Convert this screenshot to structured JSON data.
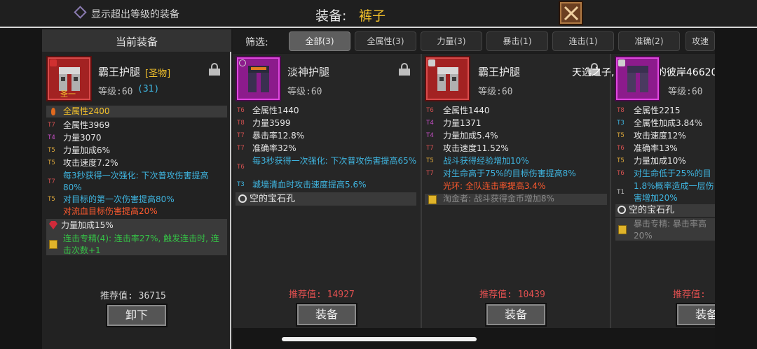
{
  "top": {
    "toggle_label": "显示超出等级的装备",
    "title_prefix": "装备:",
    "title_item": "裤子"
  },
  "left": {
    "header": "当前装备",
    "item_name": "霸王护腿",
    "item_tag": "[圣物]",
    "holy_mark": "圣一",
    "level_label": "等级:60",
    "level_bonus": "(31)",
    "stats": [
      {
        "tier": "",
        "text": "全属性2400"
      },
      {
        "tier": "T7",
        "text": "全属性3969"
      },
      {
        "tier": "T4",
        "text": "力量3070"
      },
      {
        "tier": "T5",
        "text": "力量加成6%"
      },
      {
        "tier": "T5",
        "text": "攻击速度7.2%"
      },
      {
        "tier": "T7",
        "text": "每3秒获得一次强化: 下次普攻伤害提高80%"
      },
      {
        "tier": "T5",
        "text": "对目标的第一次伤害提高80%"
      },
      {
        "tier": "",
        "text": "对流血目标伤害提高20%"
      },
      {
        "tier": "",
        "text": "力量加成15%"
      },
      {
        "tier": "",
        "text": "连击专精(4): 连击率27%, 触发连击时, 连击次数+1"
      }
    ],
    "recommend": "推荐值: 36715",
    "unequip_label": "卸下"
  },
  "filter": {
    "label": "筛选:",
    "tabs": [
      "全部(3)",
      "全属性(3)",
      "力量(3)",
      "暴击(1)",
      "连击(1)",
      "准确(2)",
      "攻速"
    ]
  },
  "cards": [
    {
      "name": "淡神护腿",
      "level": "等级:60",
      "stats": [
        {
          "tier": "T6",
          "text": "全属性1440"
        },
        {
          "tier": "T8",
          "text": "力量3599"
        },
        {
          "tier": "T7",
          "text": "暴击率12.8%"
        },
        {
          "tier": "T7",
          "text": "准确率32%"
        },
        {
          "tier": "T6",
          "text": "每3秒获得一次强化: 下次普攻伤害提高65%"
        },
        {
          "tier": "T3",
          "text": "城墙清血时攻击速度提高5.6%"
        },
        {
          "tier": "",
          "text": "空的宝石孔"
        }
      ],
      "recommend": "推荐值: 14927",
      "equip_label": "装备"
    },
    {
      "name": "霸王护腿",
      "level": "等级:60",
      "stats": [
        {
          "tier": "T6",
          "text": "全属性1440"
        },
        {
          "tier": "T4",
          "text": "力量1371"
        },
        {
          "tier": "T4",
          "text": "力量加成5.4%"
        },
        {
          "tier": "T7",
          "text": "攻击速度11.52%"
        },
        {
          "tier": "T5",
          "text": "战斗获得经验增加10%"
        },
        {
          "tier": "T7",
          "text": "对生命高于75%的目标伤害提高8%"
        },
        {
          "tier": "",
          "text": "光环: 全队连击率提高3.4%"
        },
        {
          "tier": "",
          "text": "淘金者: 战斗获得金币增加8%"
        }
      ],
      "recommend": "推荐值: 10439",
      "equip_label": "装备",
      "overlay_text": "天选之子, 玩家荒野的彼岸46620"
    },
    {
      "name": "",
      "level": "等级:60",
      "stats": [
        {
          "tier": "T8",
          "text": "全属性2215"
        },
        {
          "tier": "T3",
          "text": "全属性加成3.84%"
        },
        {
          "tier": "T5",
          "text": "攻击速度12%"
        },
        {
          "tier": "T6",
          "text": "准确率13%"
        },
        {
          "tier": "T5",
          "text": "力量加成10%"
        },
        {
          "tier": "T6",
          "text": "对生命低于25%的目"
        },
        {
          "tier": "T1",
          "text": "1.8%概率造成一层伤害增加20%"
        },
        {
          "tier": "",
          "text": "空的宝石孔"
        },
        {
          "tier": "",
          "text": "暴击专精: 暴击率高20%"
        }
      ],
      "recommend": "推荐值:",
      "equip_label": "装备"
    }
  ],
  "colors": {
    "tier_red": "#d25050",
    "tier_gold": "#d9a53a",
    "tier_purple": "#c44ec4",
    "tier_blue": "#3fb5e0",
    "text_red": "#ff5a2e",
    "text_green": "#35c246",
    "title_gold": "#f3c12b"
  }
}
